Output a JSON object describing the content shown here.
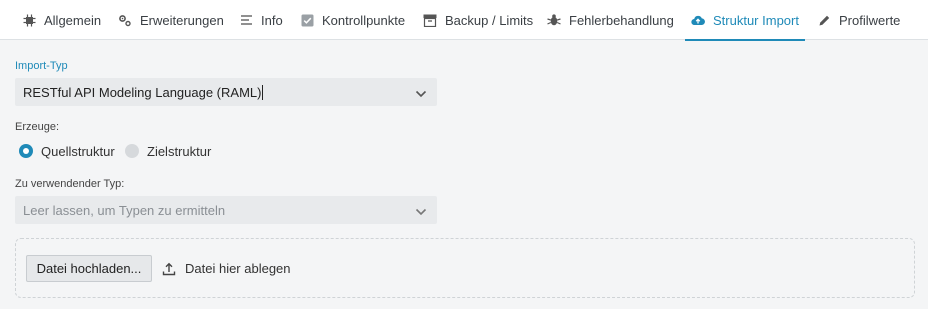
{
  "tabs": [
    {
      "label": "Allgemein",
      "icon": "chip-icon"
    },
    {
      "label": "Erweiterungen",
      "icon": "gears-icon"
    },
    {
      "label": "Info",
      "icon": "lines-icon"
    },
    {
      "label": "Kontrollpunkte",
      "icon": "checkbox-icon"
    },
    {
      "label": "Backup / Limits",
      "icon": "archive-icon"
    },
    {
      "label": "Fehlerbehandlung",
      "icon": "bug-icon"
    },
    {
      "label": "Struktur Import",
      "icon": "cloud-upload-icon",
      "active": true
    },
    {
      "label": "Profilwerte",
      "icon": "pencil-icon"
    }
  ],
  "import_type": {
    "label": "Import-Typ",
    "value": "RESTful API Modeling Language (RAML)"
  },
  "generate": {
    "label": "Erzeuge:",
    "options": [
      {
        "label": "Quellstruktur",
        "selected": true
      },
      {
        "label": "Zielstruktur",
        "selected": false
      }
    ]
  },
  "type_to_use": {
    "label": "Zu verwendender Typ:",
    "placeholder": "Leer lassen, um Typen zu ermitteln"
  },
  "upload": {
    "button_label": "Datei hochladen...",
    "drop_text": "Datei hier ablegen"
  },
  "colors": {
    "accent": "#1f8ab8",
    "background": "#f4f5f6",
    "field": "#e8eaec"
  }
}
